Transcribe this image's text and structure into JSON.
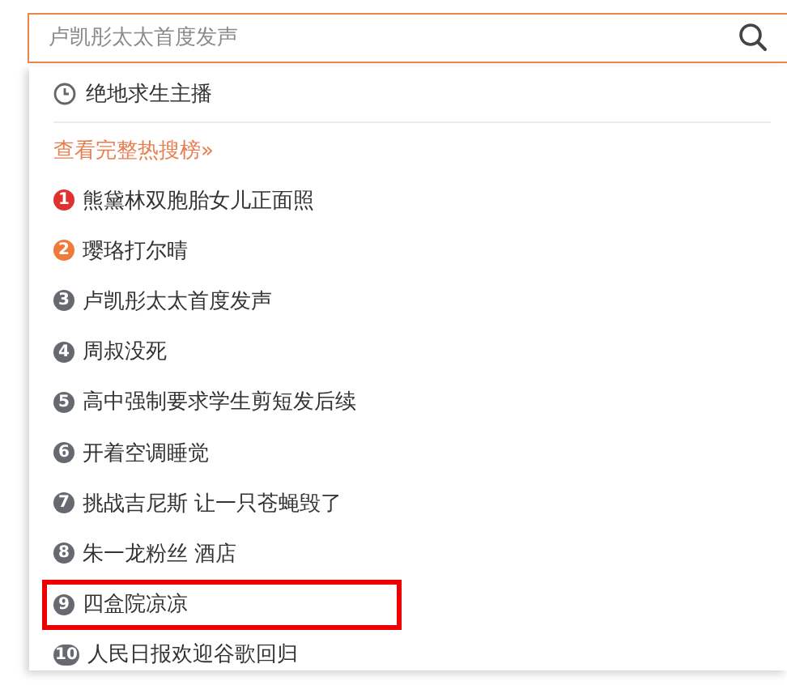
{
  "search": {
    "placeholder": "卢凯彤太太首度发声"
  },
  "history": [
    {
      "text": "绝地求生主播"
    }
  ],
  "hot_link": "查看完整热搜榜»",
  "hot_list": [
    {
      "rank": "1",
      "text": "熊黛林双胞胎女儿正面照",
      "color": "#e0312e",
      "highlighted": false
    },
    {
      "rank": "2",
      "text": "璎珞打尔晴",
      "color": "#f07a3a",
      "highlighted": false
    },
    {
      "rank": "3",
      "text": "卢凯彤太太首度发声",
      "color": "#666a70",
      "highlighted": false
    },
    {
      "rank": "4",
      "text": "周叔没死",
      "color": "#666a70",
      "highlighted": false
    },
    {
      "rank": "5",
      "text": "高中强制要求学生剪短发后续",
      "color": "#666a70",
      "highlighted": false
    },
    {
      "rank": "6",
      "text": "开着空调睡觉",
      "color": "#666a70",
      "highlighted": false
    },
    {
      "rank": "7",
      "text": "挑战吉尼斯 让一只苍蝇毁了",
      "color": "#666a70",
      "highlighted": false
    },
    {
      "rank": "8",
      "text": "朱一龙粉丝 酒店",
      "color": "#666a70",
      "highlighted": false
    },
    {
      "rank": "9",
      "text": "四盒院凉凉",
      "color": "#666a70",
      "highlighted": true
    },
    {
      "rank": "10",
      "text": "人民日报欢迎谷歌回归",
      "color": "#666a70",
      "highlighted": false
    }
  ]
}
